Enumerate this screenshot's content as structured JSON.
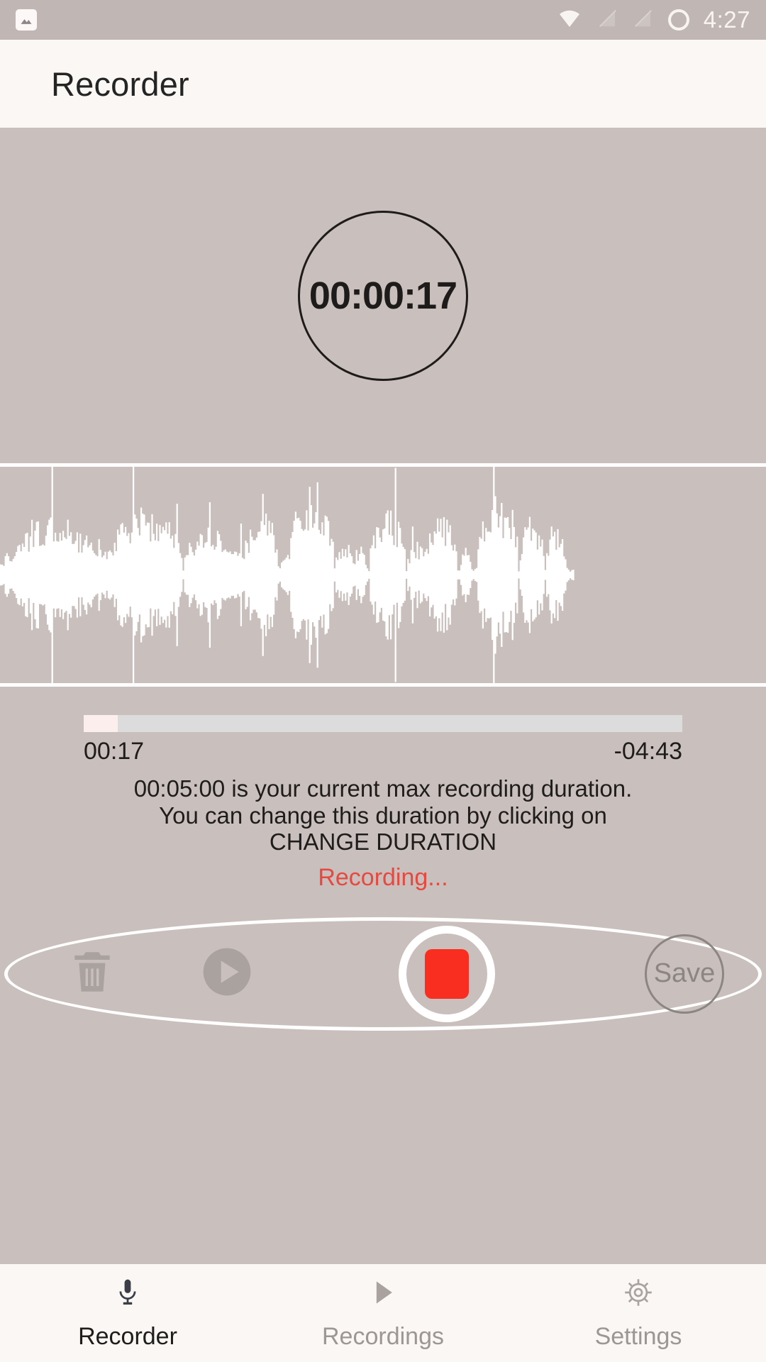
{
  "statusbar": {
    "notification_icon": "photo-icon",
    "wifi_icon": "wifi-icon",
    "signal_off_icon_1": "signal-no-sim-icon",
    "signal_off_icon_2": "signal-no-sim-icon",
    "ring_icon": "circle-ring-icon",
    "time": "4:27"
  },
  "appbar": {
    "title": "Recorder"
  },
  "timer": {
    "elapsed": "00:00:17"
  },
  "waveform": {
    "label": "audio-waveform"
  },
  "seek": {
    "progress_percent": 5.7,
    "elapsed": "00:17",
    "remaining": "-04:43"
  },
  "info": {
    "line1": "00:05:00 is your current max recording duration.",
    "line2": "You can change this duration by clicking on",
    "line3": "CHANGE DURATION",
    "status": "Recording..."
  },
  "controls": {
    "delete_icon": "trash-icon",
    "play_icon": "play-circle-icon",
    "record_icon": "stop-record-icon",
    "save_label": "Save"
  },
  "bottomnav": {
    "items": [
      {
        "label": "Recorder",
        "icon": "microphone-icon",
        "active": true
      },
      {
        "label": "Recordings",
        "icon": "play-icon",
        "active": false
      },
      {
        "label": "Settings",
        "icon": "gear-icon",
        "active": false
      }
    ]
  },
  "colors": {
    "background": "#c9c0bd",
    "appbar": "#faf7f5",
    "statusbar": "#c0b7b4",
    "accent_red": "#f92e20",
    "status_red": "#e8483f",
    "track": "#dcdcdc",
    "track_fill": "#fbeeec",
    "disabled_gray": "#8c8683"
  }
}
